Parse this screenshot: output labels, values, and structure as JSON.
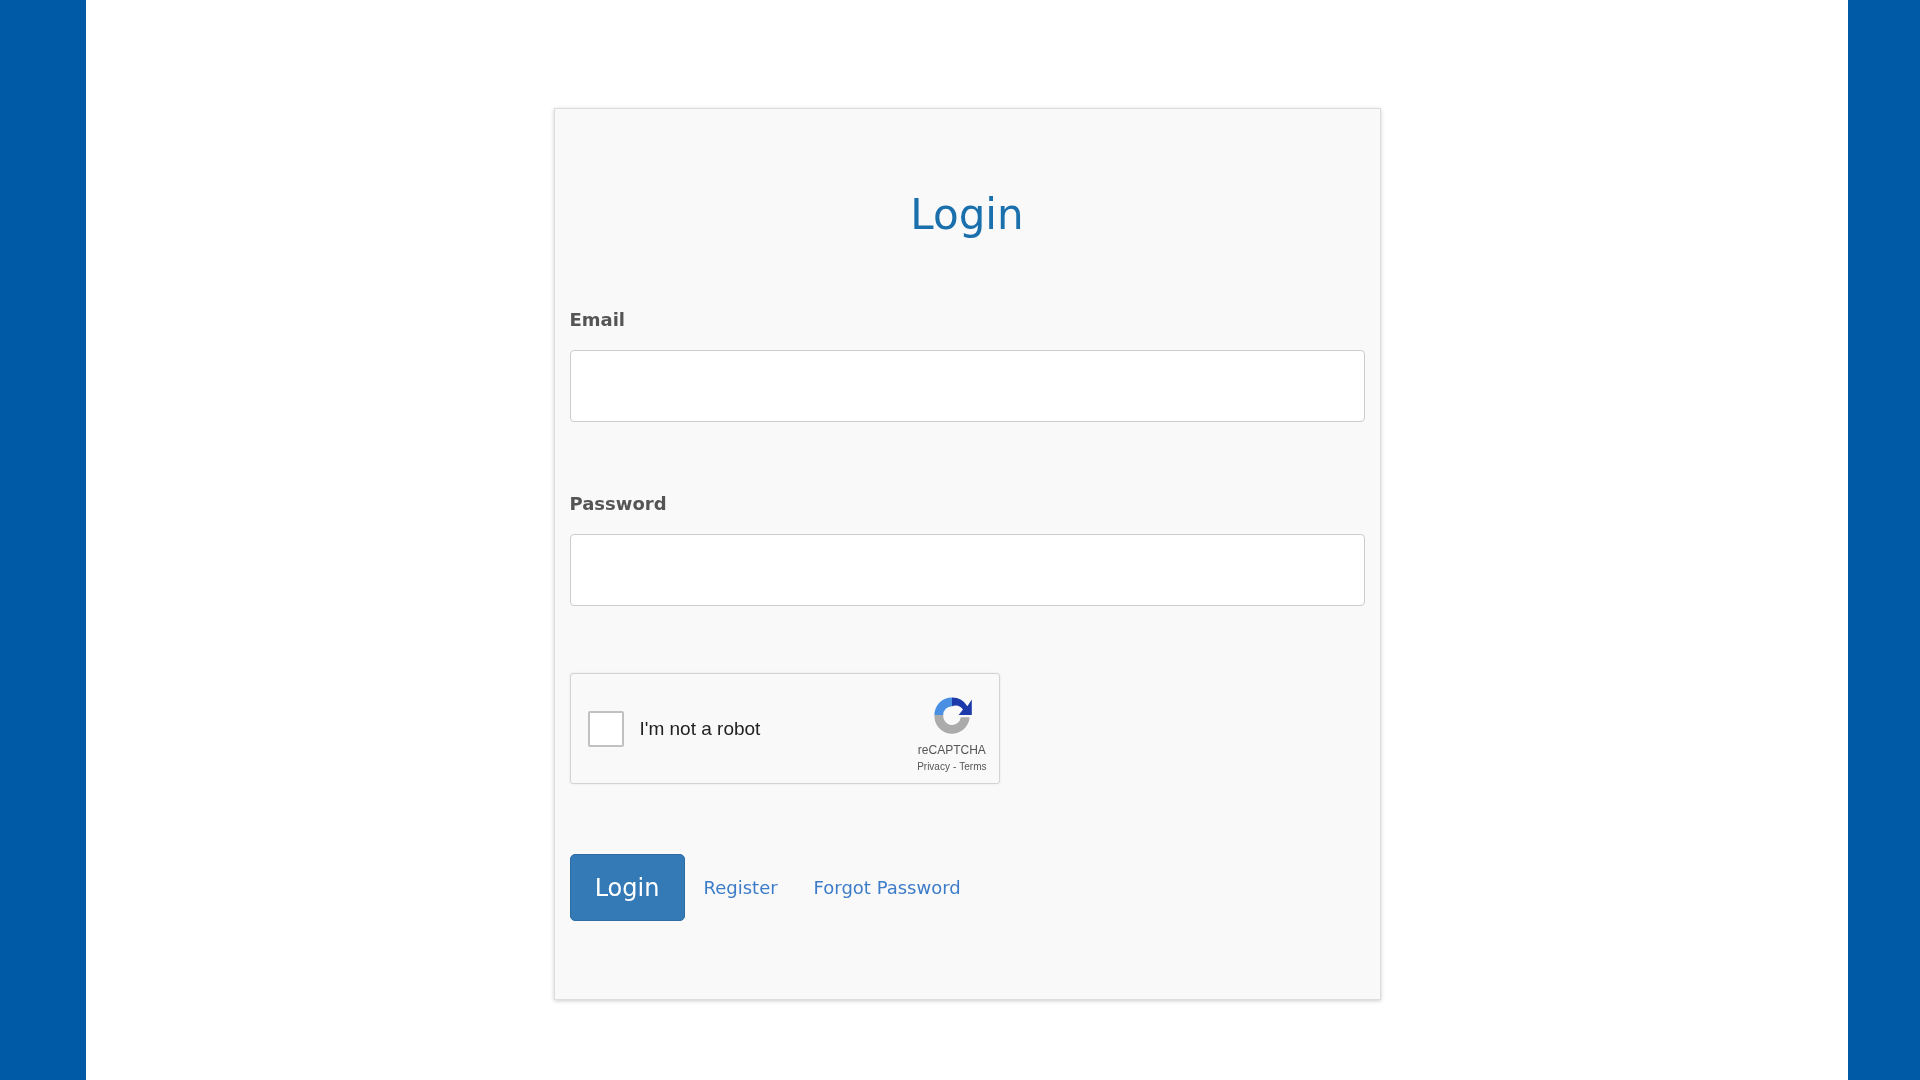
{
  "title": "Login",
  "fields": [
    {
      "label": "Email"
    },
    {
      "label": "Password"
    }
  ],
  "captcha": {
    "label": "I'm not a robot",
    "checked": false,
    "brand": "reCAPTCHA",
    "links": [
      "Privacy",
      "Terms"
    ],
    "separator": "-"
  },
  "submit_button": "Login",
  "links": [
    "Register",
    "Forgot Password"
  ]
}
